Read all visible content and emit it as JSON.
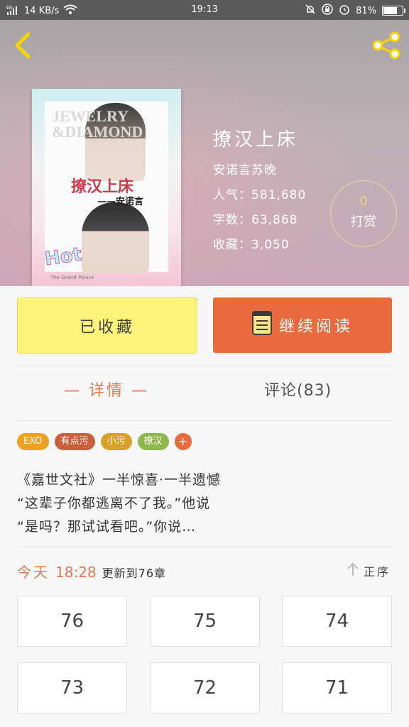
{
  "status_bar": {
    "signal_label": "4G",
    "speed": "14 KB/s",
    "time": "19:13",
    "battery": "81%",
    "battery_level": 0.81
  },
  "book": {
    "title": "撩汉上床",
    "author": "安诺言苏晚",
    "popularity": "人气：581,680",
    "word_count": "字数：63,868",
    "favorites": "收藏：3,050"
  },
  "cover": {
    "text_en": "JEWELRY &DIAMOND",
    "title": "撩汉上床",
    "author": "——安诺言",
    "badge": "Hot",
    "publisher": "The Grand Palace"
  },
  "reward": {
    "count": "0",
    "label": "打赏"
  },
  "actions": {
    "collected_label": "已收藏",
    "continue_label": "继续阅读"
  },
  "tabs": {
    "details": "— 详情 —",
    "comments": "评论(83)"
  },
  "tags": [
    {
      "label": "EXO",
      "color": "#f0a020"
    },
    {
      "label": "有点污",
      "color": "#c9603c"
    },
    {
      "label": "小污",
      "color": "#d9a02c"
    },
    {
      "label": "撩汉",
      "color": "#8fb84c"
    }
  ],
  "tag_add": "+",
  "description": [
    "《嘉世文社》一半惊喜·一半遗憾",
    "“这辈子你都逃离不了我。”他说",
    "“是吗？那试试看吧。”你说…"
  ],
  "update": {
    "day": "今天",
    "time": "18:28",
    "text": "更新到76章"
  },
  "sort_label": "正序",
  "chapters": [
    "76",
    "75",
    "74",
    "73",
    "72",
    "71"
  ],
  "colors": {
    "accent": "#e86a3d",
    "collected_bg": "#fdf27a",
    "highlight": "#e8774a"
  }
}
